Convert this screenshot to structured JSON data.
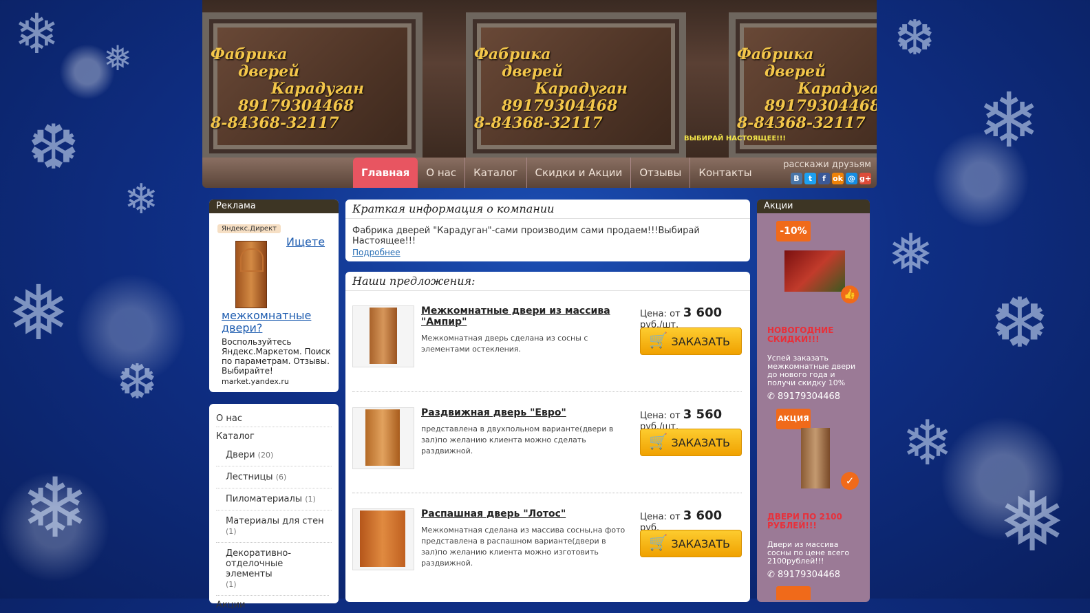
{
  "header": {
    "panel_lines": [
      "Фабрика",
      "дверей",
      "Карадуган",
      "89179304468",
      "8-84368-32117"
    ],
    "slogan": "ВЫБИРАЙ НАСТОЯЩЕЕ!!!"
  },
  "nav": {
    "items": [
      "Главная",
      "О нас",
      "Каталог",
      "Скидки и Акции",
      "Отзывы",
      "Контакты"
    ],
    "active": "Главная",
    "share_label": "расскажи друзьям",
    "share_icons": [
      "vk-icon",
      "twitter-icon",
      "facebook-icon",
      "odnoklassniki-icon",
      "mail-icon",
      "googleplus-icon"
    ]
  },
  "left": {
    "ad_title": "Реклама",
    "ad_badge": "Яндекс.Директ",
    "ad_link_1": "Ищете",
    "ad_link_2": "межкомнатные двери?",
    "ad_desc": "Воспользуйтесь Яндекс.Маркетом. Поиск по параметрам. Отзывы. Выбирайте!",
    "ad_domain": "market.yandex.ru",
    "menu_top": [
      "О нас",
      "Каталог"
    ],
    "menu_sub": [
      {
        "label": "Двери",
        "count": "(20)"
      },
      {
        "label": "Лестницы",
        "count": "(6)"
      },
      {
        "label": "Пиломатериалы",
        "count": "(1)"
      },
      {
        "label": "Материалы для стен",
        "count": "(1)"
      },
      {
        "label": "Декоративно-отделочные элементы",
        "count": "(1)"
      }
    ],
    "menu_bottom": "Акции"
  },
  "center": {
    "about_title": "Краткая информация о компании",
    "about_text": "Фабрика дверей \"Карадуган\"-сами производим сами продаем!!!Выбирай Настоящее!!!",
    "about_more": "Подробнее",
    "offers_title": "Наши предложения:",
    "price_label": "Цена: от",
    "order_label": "ЗАКАЗАТЬ",
    "offers": [
      {
        "title": "Межкомнатные двери из массива \"Ампир\"",
        "desc": "Межкомнатная дверь сделана из сосны с элементами остекления.",
        "price": "3 600",
        "unit": "руб./шт."
      },
      {
        "title": "Раздвижная дверь \"Евро\"",
        "desc": "представлена в двухпольном варианте(двери в зал)по желанию клиента можно сделать раздвижной.",
        "price": "3 560",
        "unit": "руб./шт."
      },
      {
        "title": "Распашная дверь \"Лотос\"",
        "desc": "Межкомнатная сделана из массива сосны,на фото представлена в распашном варианте(двери в зал)по желанию клиента можно изготовить раздвижной.",
        "price": "3 600",
        "unit": "руб."
      }
    ]
  },
  "right": {
    "title": "Акции",
    "badge_1": "-10%",
    "promo_1_title": "НОВОГОДНИЕ СКИДКИ!!!",
    "promo_1_text": "Успей заказать межкомнатные двери до нового года и получи скидку 10%",
    "phone": "89179304468",
    "badge_2": "АКЦИЯ",
    "promo_2_title": "ДВЕРИ ПО 2100 РУБЛЕЙ!!!",
    "promo_2_text": "Двери из массива сосны по цене всего 2100рублей!!!",
    "colors": {
      "promo_bg": "#9b7a96",
      "accent": "#e8303a",
      "badge": "#f06a1a"
    }
  }
}
